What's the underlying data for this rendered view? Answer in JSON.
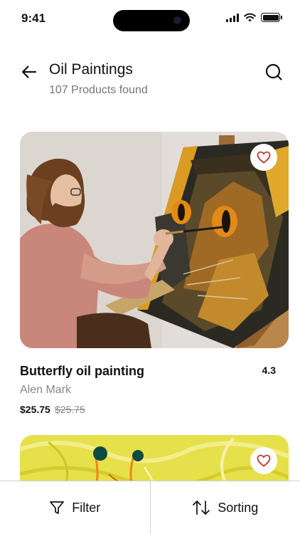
{
  "status_bar": {
    "time": "9:41"
  },
  "header": {
    "title": "Oil Paintings",
    "subtitle": "107 Products found"
  },
  "products": [
    {
      "name": "Butterfly oil painting",
      "rating": "4.3",
      "artist": "Alen Mark",
      "price": "$25.75",
      "old_price": "$25.75"
    },
    {
      "name": "",
      "rating": "",
      "artist": "",
      "price": "",
      "old_price": ""
    }
  ],
  "bottom_bar": {
    "filter_label": "Filter",
    "sorting_label": "Sorting"
  },
  "colors": {
    "text_primary": "#111111",
    "text_secondary": "#777777",
    "heart": "#c0392b",
    "divider": "#cfcfcf"
  },
  "icons": {
    "back": "arrow-left-icon",
    "search": "search-icon",
    "favorite": "heart-icon",
    "filter": "filter-icon",
    "sort": "sort-arrows-icon"
  }
}
